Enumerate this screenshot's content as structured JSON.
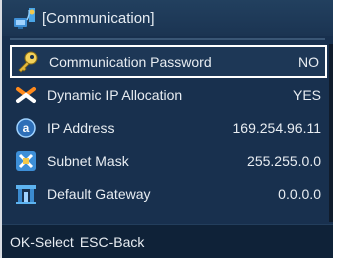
{
  "title": "[Communication]",
  "menu": {
    "items": [
      {
        "label": "Communication Password",
        "value": "NO",
        "icon": "key-icon"
      },
      {
        "label": "Dynamic IP Allocation",
        "value": "YES",
        "icon": "dynamic-ip-icon"
      },
      {
        "label": "IP Address",
        "value": "169.254.96.11",
        "icon": "ip-address-icon"
      },
      {
        "label": "Subnet Mask",
        "value": "255.255.0.0",
        "icon": "subnet-mask-icon"
      },
      {
        "label": "Default Gateway",
        "value": "0.0.0.0",
        "icon": "gateway-icon"
      }
    ]
  },
  "footer": {
    "ok_hint": "OK-Select",
    "esc_hint": "ESC-Back"
  },
  "colors": {
    "background": "#18304e",
    "selection_border": "#ffffff",
    "text": "#e8edf2"
  }
}
